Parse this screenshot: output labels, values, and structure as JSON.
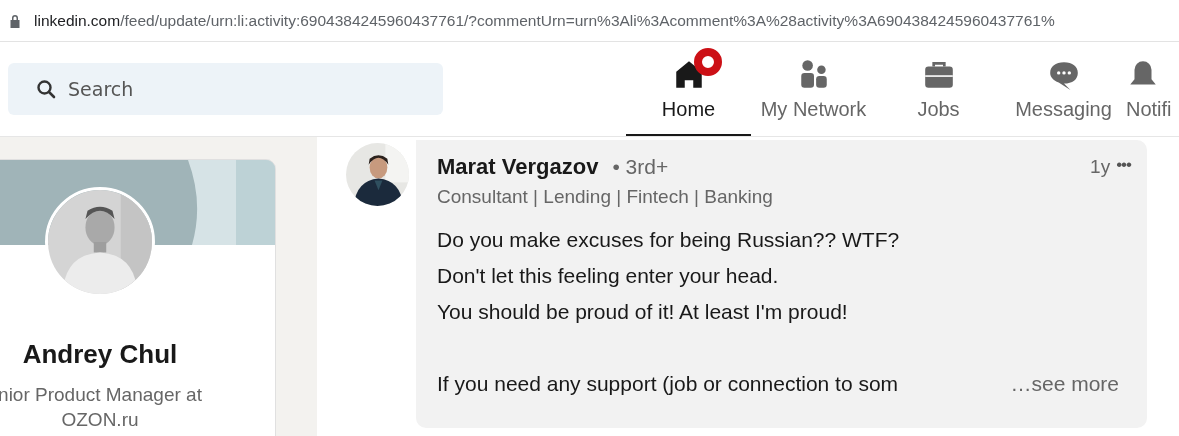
{
  "address_bar": {
    "url_host": "linkedin.com",
    "url_path": "/feed/update/urn:li:activity:6904384245960437761/?commentUrn=urn%3Ali%3Acomment%3A%28activity%3A6904384245960437761%"
  },
  "search": {
    "placeholder": "Search"
  },
  "nav": [
    {
      "label": "Home",
      "kind": "home",
      "selected": true,
      "badge": true
    },
    {
      "label": "My Network",
      "kind": "network",
      "selected": false,
      "badge": false
    },
    {
      "label": "Jobs",
      "kind": "jobs",
      "selected": false,
      "badge": false
    },
    {
      "label": "Messaging",
      "kind": "messaging",
      "selected": false,
      "badge": false
    },
    {
      "label": "Notifi",
      "kind": "notifications",
      "selected": false,
      "badge": false
    }
  ],
  "profile_card": {
    "name": "Andrey Chul",
    "headline_lines": [
      "nior Product Manager at",
      "OZON.ru"
    ]
  },
  "comment": {
    "author": "Marat Vergazov",
    "degree": "• 3rd+",
    "headline": "Consultant | Lending | Fintech | Banking",
    "time": "1y",
    "more": "•••",
    "paragraphs": [
      [
        "Do you make excuses for being Russian?? WTF?",
        "Don't let this feeling enter your head.",
        "You should be proud of it! At least I'm proud!"
      ],
      [
        "If you need any support (job or connection to som"
      ]
    ],
    "see_more": "…see more"
  }
}
